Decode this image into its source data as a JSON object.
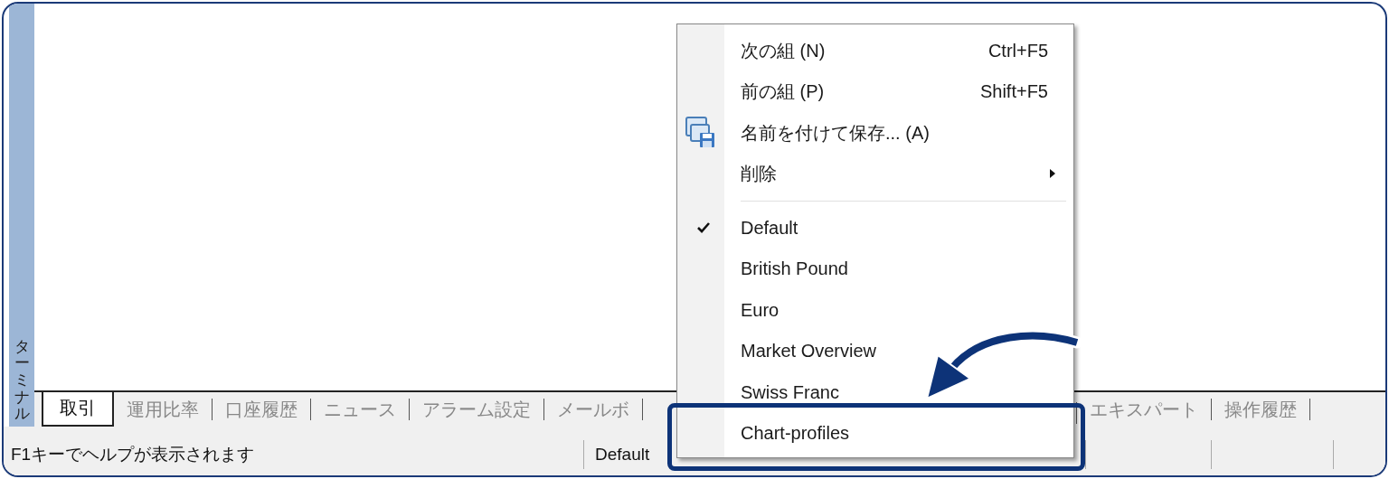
{
  "side_panel": {
    "title": "ターミナル"
  },
  "tabs": [
    {
      "label": "取引",
      "selected": true
    },
    {
      "label": "運用比率",
      "selected": false
    },
    {
      "label": "口座履歴",
      "selected": false
    },
    {
      "label": "ニュース",
      "selected": false
    },
    {
      "label": "アラーム設定",
      "selected": false
    },
    {
      "label": "メールボ",
      "selected": false
    }
  ],
  "tabs_right": [
    {
      "label": "エキスパート",
      "selected": false
    },
    {
      "label": "操作履歴",
      "selected": false
    }
  ],
  "status_bar": {
    "message": "F1キーでヘルプが表示されます",
    "profile": "Default"
  },
  "context_menu": {
    "items": [
      {
        "kind": "command",
        "label": "次の組 (N)",
        "shortcut": "Ctrl+F5"
      },
      {
        "kind": "command",
        "label": "前の組 (P)",
        "shortcut": "Shift+F5"
      },
      {
        "kind": "save",
        "label": "名前を付けて保存... (A)"
      },
      {
        "kind": "submenu",
        "label": "削除"
      },
      {
        "kind": "separator"
      },
      {
        "kind": "profile",
        "label": "Default",
        "checked": true,
        "highlighted": false
      },
      {
        "kind": "profile",
        "label": "British Pound",
        "checked": false,
        "highlighted": false
      },
      {
        "kind": "profile",
        "label": "Euro",
        "checked": false,
        "highlighted": false
      },
      {
        "kind": "profile",
        "label": "Market Overview",
        "checked": false,
        "highlighted": false
      },
      {
        "kind": "profile",
        "label": "Swiss Franc",
        "checked": false,
        "highlighted": false
      },
      {
        "kind": "profile",
        "label": "Chart-profiles",
        "checked": false,
        "highlighted": true
      }
    ]
  }
}
